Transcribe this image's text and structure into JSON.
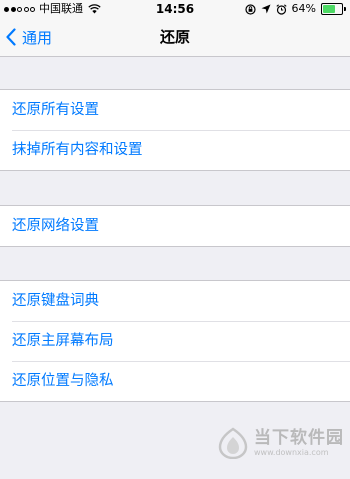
{
  "status_bar": {
    "carrier": "中国联通",
    "time": "14:56",
    "battery": "64%",
    "battery_level": 0.64
  },
  "nav": {
    "back_label": "通用",
    "title": "还原"
  },
  "groups": [
    [
      "还原所有设置",
      "抹掉所有内容和设置"
    ],
    [
      "还原网络设置"
    ],
    [
      "还原键盘词典",
      "还原主屏幕布局",
      "还原位置与隐私"
    ]
  ],
  "watermark": {
    "title": "当下软件园",
    "url": "www.downxia.com"
  },
  "colors": {
    "accent": "#007aff",
    "background": "#efeff4",
    "battery": "#4cd964"
  }
}
